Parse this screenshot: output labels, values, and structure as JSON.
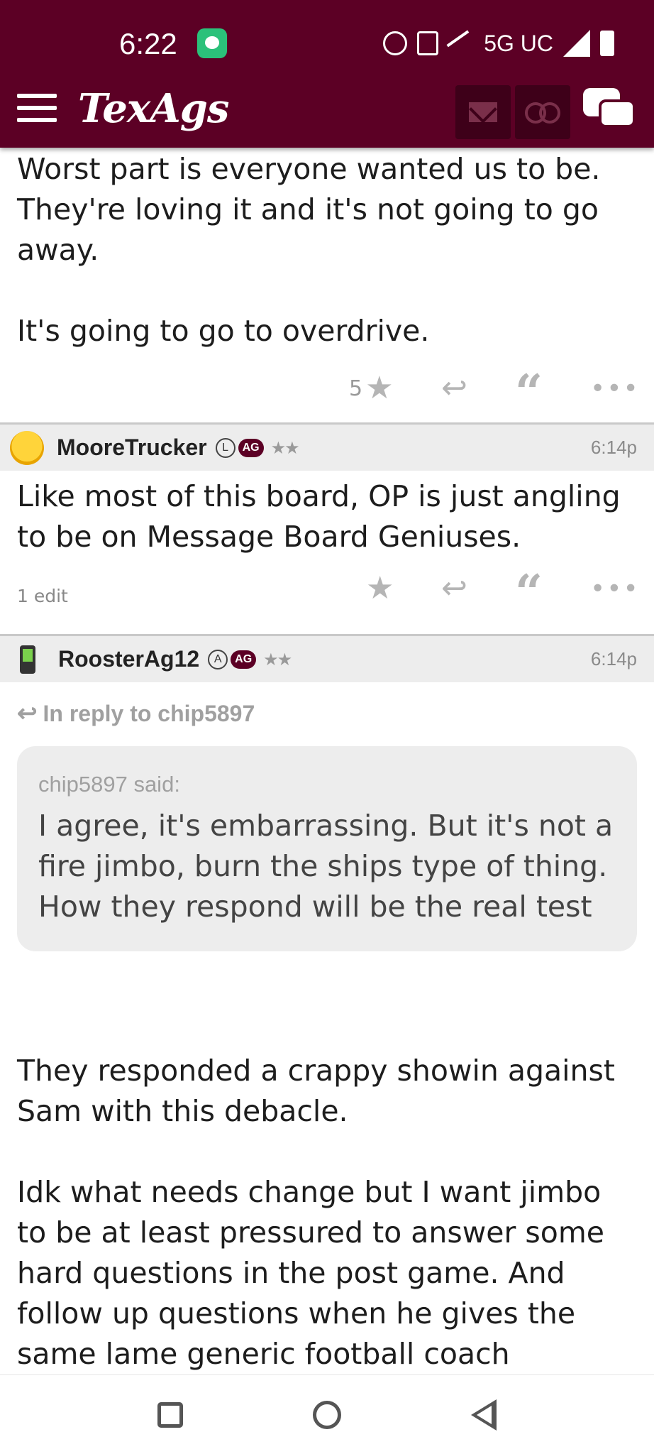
{
  "status_bar": {
    "time": "6:22",
    "network": "5G UC"
  },
  "header": {
    "logo": "TexAgs",
    "icons": [
      "menu-icon",
      "mail-icon",
      "binoculars-icon",
      "chat-bubbles-icon"
    ]
  },
  "posts": [
    {
      "body": [
        "Worst part is everyone wanted us to be. They're loving it and it's not going to go away.",
        "It's going to go to overdrive."
      ],
      "star_count": "5"
    },
    {
      "username": "MooreTrucker",
      "badge_letter": "L",
      "badge_ag": "AG",
      "time": "6:14p",
      "body": "Like most of this board, OP is just angling to be on Message Board Geniuses.",
      "edit_note": "1 edit"
    },
    {
      "username": "RoosterAg12",
      "badge_letter": "A",
      "badge_ag": "AG",
      "time": "6:14p",
      "reply_to": "In reply to chip5897",
      "quote_author": "chip5897 said:",
      "quote": "I agree, it's embarrassing. But it's not a fire jimbo, burn the ships type of thing. How they respond will be the real test",
      "body": [
        "They responded a crappy showin against Sam with this debacle.",
        "Idk what needs change but I want jimbo to be at least pressured to answer some hard questions in the post game. And follow up questions when he gives the same lame generic football coach"
      ]
    }
  ],
  "colors": {
    "brand": "#5c0025",
    "header_bg": "#ededed",
    "icon_gray": "#b5b5b5"
  }
}
